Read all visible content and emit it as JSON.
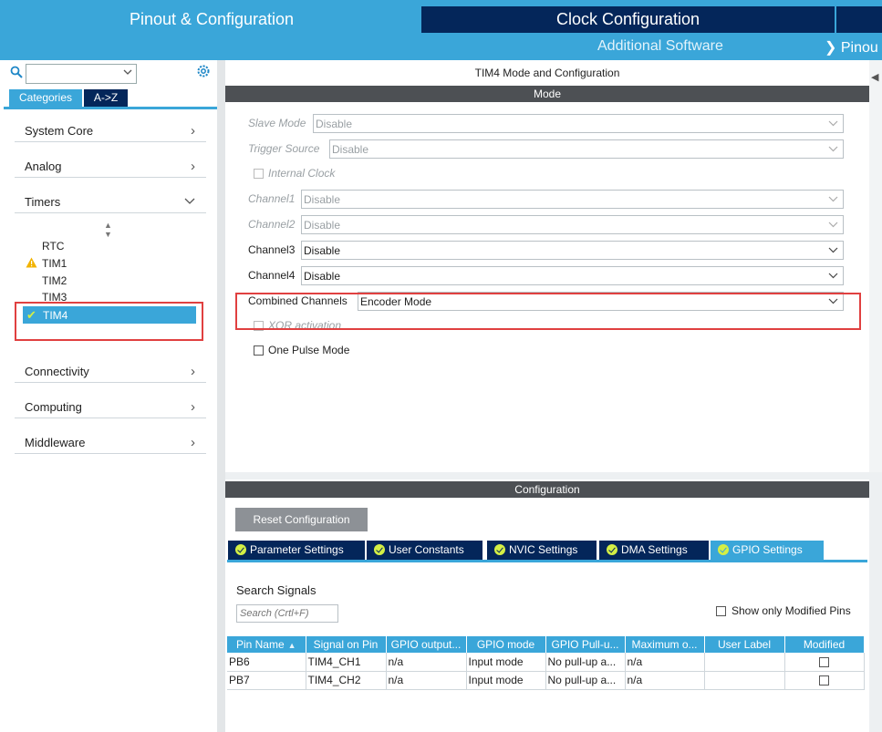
{
  "top_tabs": {
    "pinout": "Pinout & Configuration",
    "clock": "Clock Configuration",
    "additional": "Additional Software",
    "pinout_sub": "Pinou"
  },
  "left": {
    "categories_tab": "Categories",
    "az_tab": "A->Z",
    "categories": [
      {
        "label": "System Core",
        "expanded": false
      },
      {
        "label": "Analog",
        "expanded": false
      },
      {
        "label": "Timers",
        "expanded": true
      },
      {
        "label": "Connectivity",
        "expanded": false
      },
      {
        "label": "Computing",
        "expanded": false
      },
      {
        "label": "Middleware",
        "expanded": false
      }
    ],
    "timers": [
      "RTC",
      "TIM1",
      "TIM2",
      "TIM3",
      "TIM4"
    ],
    "selected_timer": "TIM4"
  },
  "mode": {
    "title": "TIM4 Mode and Configuration",
    "header": "Mode",
    "fields": [
      {
        "label": "Slave Mode",
        "value": "Disable"
      },
      {
        "label": "Trigger Source",
        "value": "Disable"
      },
      {
        "label": "Channel1",
        "value": "Disable"
      },
      {
        "label": "Channel2",
        "value": "Disable"
      },
      {
        "label": "Channel3",
        "value": "Disable"
      },
      {
        "label": "Channel4",
        "value": "Disable"
      },
      {
        "label": "Combined Channels",
        "value": "Encoder Mode"
      }
    ],
    "internal_clock": "Internal Clock",
    "xor_activation": "XOR activation",
    "one_pulse_mode": "One Pulse Mode"
  },
  "config": {
    "header": "Configuration",
    "reset_button": "Reset Configuration",
    "tabs": [
      "Parameter Settings",
      "User Constants",
      "NVIC Settings",
      "DMA Settings",
      "GPIO Settings"
    ],
    "active_tab": "GPIO Settings",
    "search_label": "Search Signals",
    "search_placeholder": "Search (Crtl+F)",
    "show_modified": "Show only Modified Pins",
    "table": {
      "columns": [
        "Pin Name",
        "Signal on Pin",
        "GPIO output...",
        "GPIO mode",
        "GPIO Pull-u...",
        "Maximum o...",
        "User Label",
        "Modified"
      ],
      "rows": [
        [
          "PB6",
          "TIM4_CH1",
          "n/a",
          "Input mode",
          "No pull-up a...",
          "n/a",
          "",
          ""
        ],
        [
          "PB7",
          "TIM4_CH2",
          "n/a",
          "Input mode",
          "No pull-up a...",
          "n/a",
          "",
          ""
        ]
      ]
    }
  },
  "colors": {
    "accent": "#3aa6d9",
    "navy": "#04265a",
    "header_gray": "#4d5054",
    "highlight_red": "#e04040",
    "check_green": "#d4ef45"
  }
}
